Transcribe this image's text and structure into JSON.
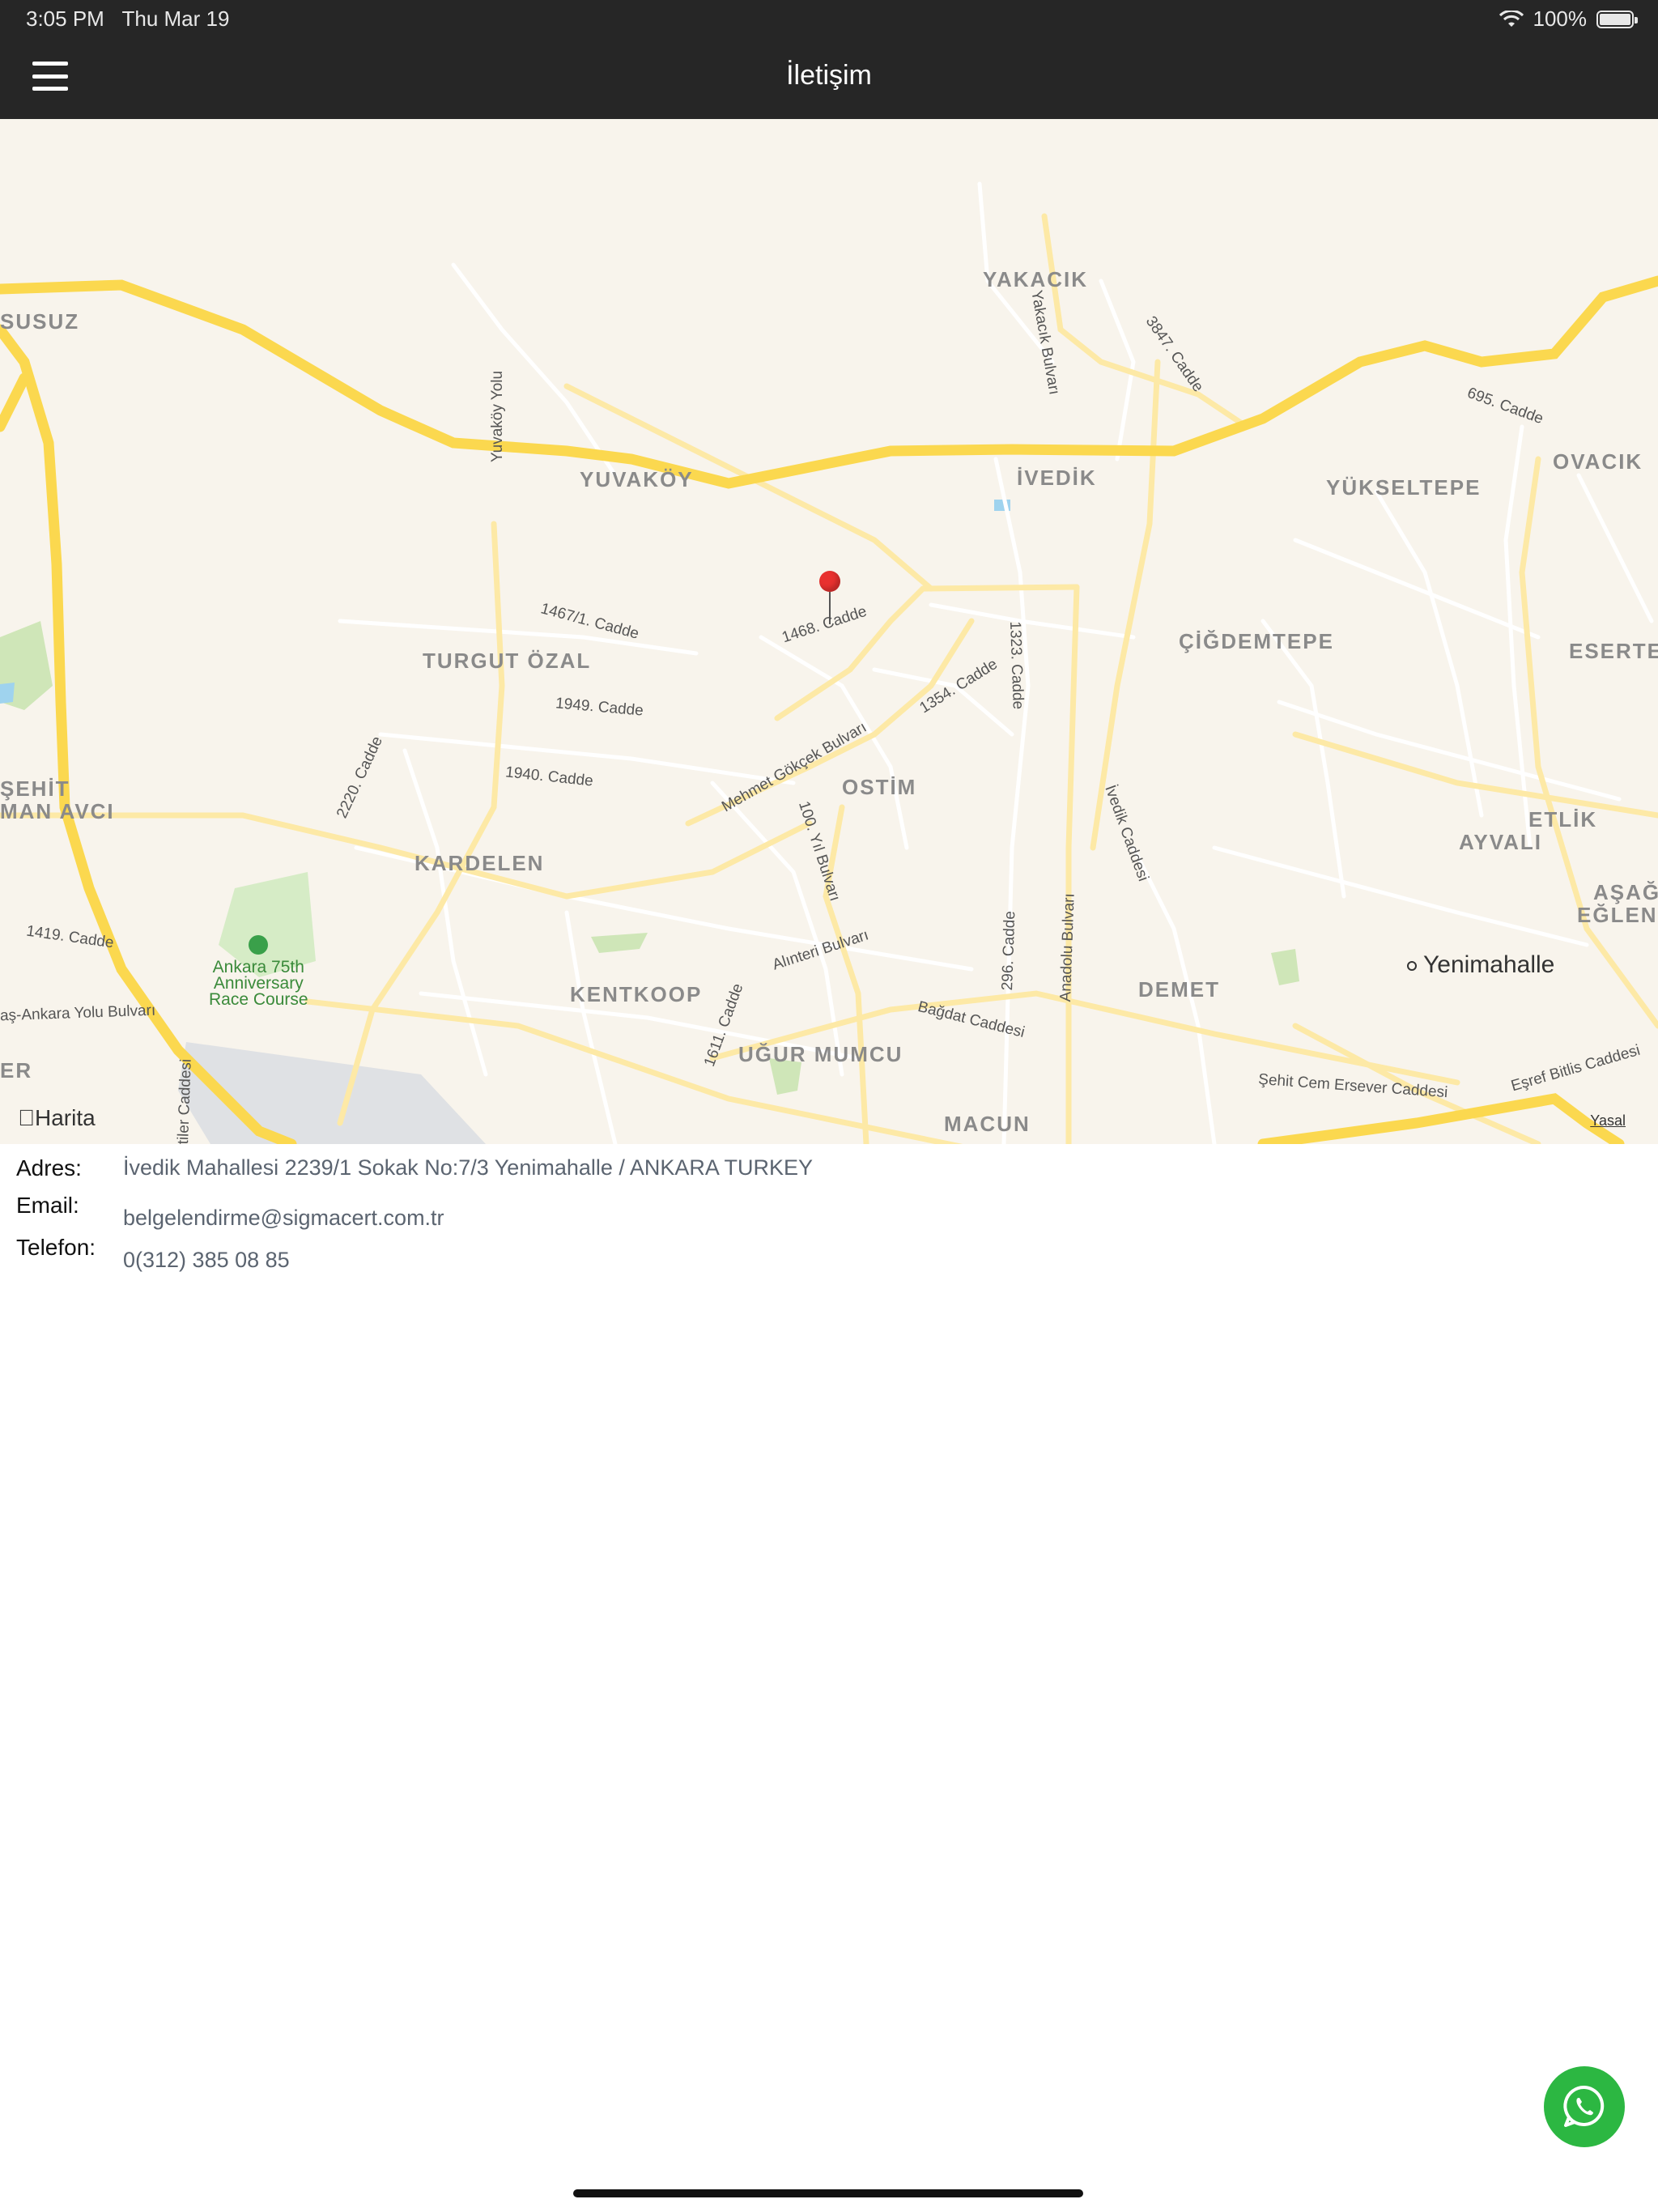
{
  "status_bar": {
    "time": "3:05 PM",
    "date": "Thu Mar 19",
    "battery": "100%",
    "battery_level": 1.0
  },
  "nav": {
    "title": "İletişim",
    "menu_icon": "hamburger-menu-icon"
  },
  "map": {
    "brand": "Harita",
    "legal": "Yasal",
    "districts": [
      "SUSUZ",
      "YAKACIK",
      "YUVAKÖY",
      "İVEDİK",
      "YÜKSELTEPE",
      "OVACIK",
      "ÇİĞDEMTEPE",
      "ESERTE",
      "TURGUT ÖZAL",
      "OSTİM",
      "ŞEHİT",
      "MAN AVCI",
      "KARDELEN",
      "ETLİK",
      "AYVALI",
      "AŞAĞ",
      "EĞLENC",
      "KENTKOOP",
      "DEMET",
      "UĞUR MUMCU",
      "MACUN",
      "ER"
    ],
    "roads": [
      "Yakacık Bulvarı",
      "3847. Cadde",
      "695. Cadde",
      "Yuvaköy Yolu",
      "1467/1. Cadde",
      "1468. Cadde",
      "1323. Cadde",
      "1354. Cadde",
      "2220. Cadde",
      "1949. Cadde",
      "Mehmet Gökçek Bulvarı",
      "1940. Cadde",
      "İvedik Caddesi",
      "100. Yıl Bulvarı",
      "Anadolu Bulvarı",
      "Alınteri Bulvarı",
      "296. Cadde",
      "1419. Cadde",
      "aş-Ankara Yolu Bulvarı",
      "1611. Cadde",
      "Bağdat Caddesi",
      "Şehit Cem Ersever Caddesi",
      "Eşref Bitlis Caddesi",
      "tiler Caddesi"
    ],
    "city": "Yenimahalle",
    "poi": [
      "Ankara 75th",
      "Anniversary",
      "Race Course"
    ]
  },
  "contact": {
    "address_label": "Adres:",
    "address": "İvedik Mahallesi 2239/1 Sokak No:7/3 Yenimahalle / ANKARA TURKEY",
    "email_label": "Email:",
    "email": "belgelendirme@sigmacert.com.tr",
    "phone_label": "Telefon:",
    "phone": "0(312) 385 08 85"
  },
  "colors": {
    "nav_bg": "#262626",
    "map_bg": "#f8f4ec",
    "highway": "#fbd84f",
    "road": "#ffffff",
    "pin": "#e8312f",
    "whatsapp": "#2cb742"
  },
  "whatsapp_icon": "whatsapp-icon"
}
